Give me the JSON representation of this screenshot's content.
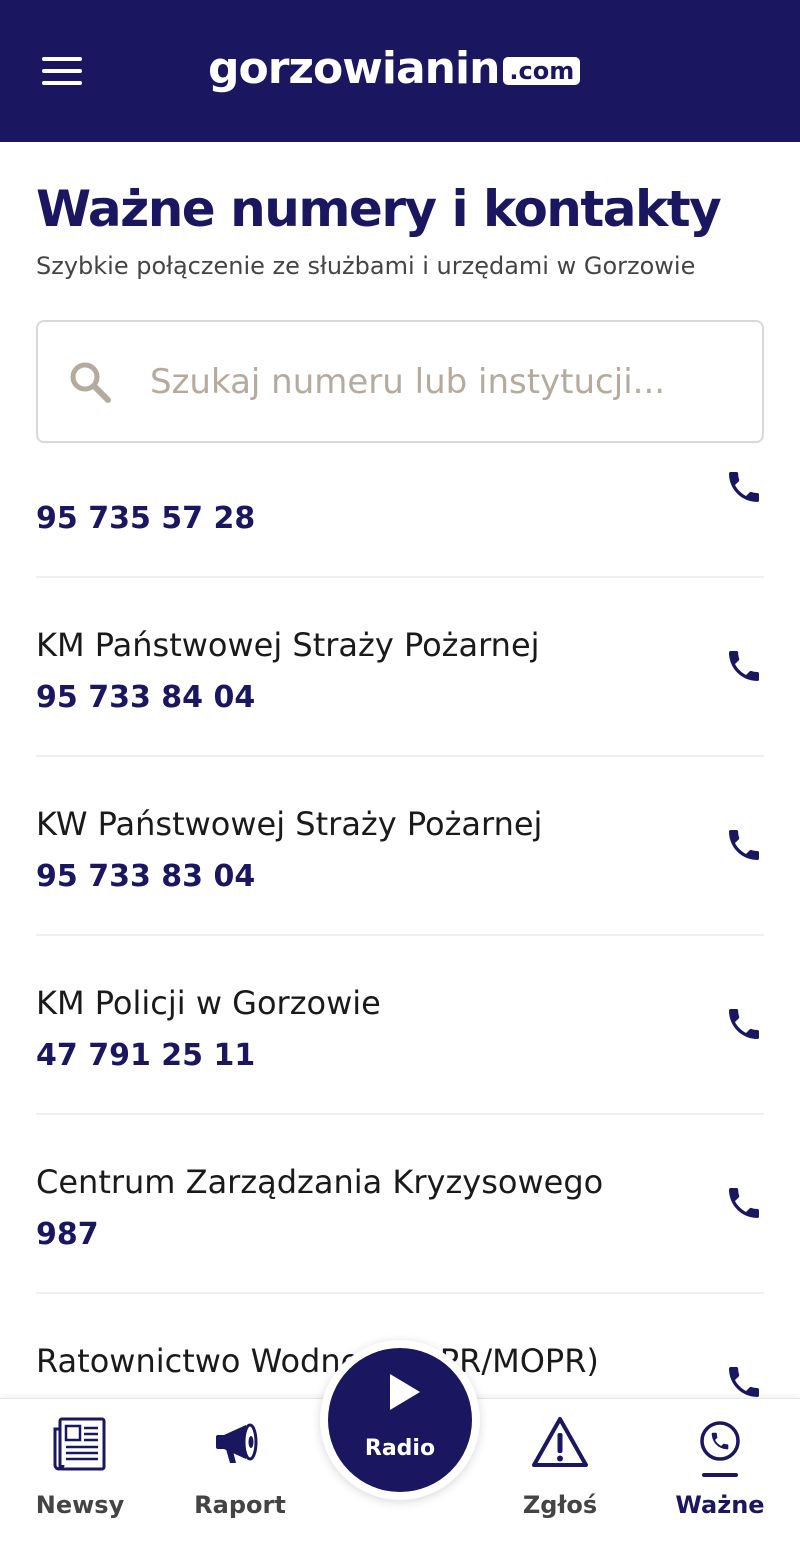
{
  "app": {
    "logo_main": "gorzowianin",
    "logo_tld": ".com"
  },
  "page": {
    "title": "Ważne numery i kontakty",
    "subtitle": "Szybkie połączenie ze służbami i urzędami w Gorzowie"
  },
  "search": {
    "placeholder": "Szukaj numeru lub instytucji...",
    "value": ""
  },
  "contacts": [
    {
      "name": "",
      "number": "95 735 57 28"
    },
    {
      "name": "KM Państwowej Straży Pożarnej",
      "number": "95 733 84 04"
    },
    {
      "name": "KW Państwowej Straży Pożarnej",
      "number": "95 733 83 04"
    },
    {
      "name": "KM Policji w Gorzowie",
      "number": "47 791 25 11"
    },
    {
      "name": "Centrum Zarządzania Kryzysowego",
      "number": "987"
    },
    {
      "name": "Ratownictwo Wodne (WOPR/MOPR)",
      "number": ""
    }
  ],
  "nav": {
    "items": [
      {
        "label": "Newsy",
        "icon": "newspaper-icon"
      },
      {
        "label": "Raport",
        "icon": "megaphone-icon"
      },
      {
        "label": "Zgłoś",
        "icon": "warning-icon"
      },
      {
        "label": "Ważne",
        "icon": "phone-circle-icon"
      }
    ],
    "radio_label": "Radio",
    "active": "Ważne"
  },
  "colors": {
    "brand": "#1a1660",
    "placeholder": "#b5aa9e",
    "text": "#1a1a1a"
  }
}
